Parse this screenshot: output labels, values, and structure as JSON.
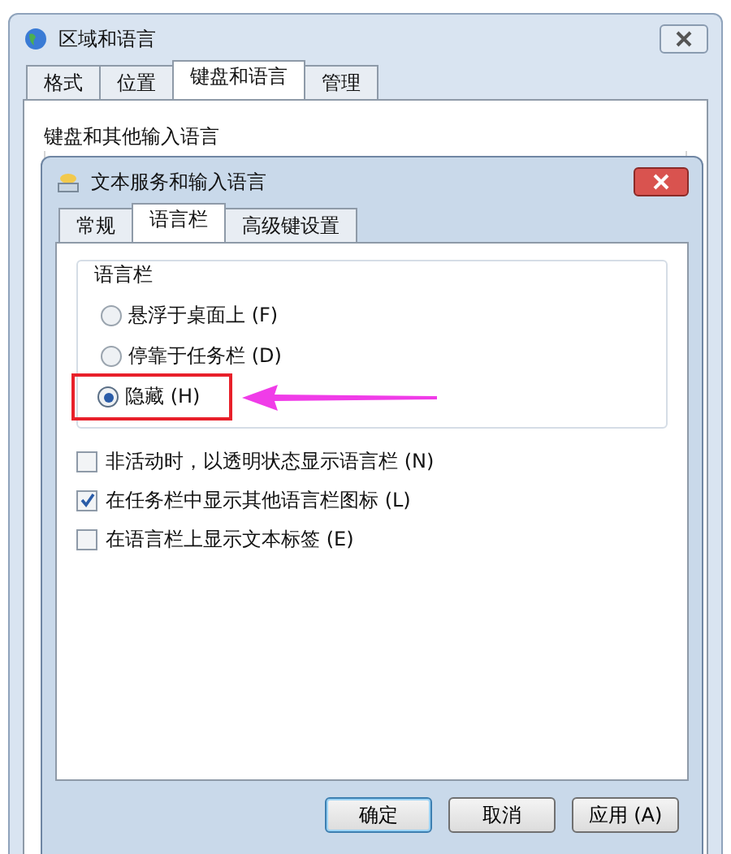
{
  "window": {
    "title": "区域和语言"
  },
  "tabs": [
    {
      "label": "格式",
      "selected": false
    },
    {
      "label": "位置",
      "selected": false
    },
    {
      "label": "键盘和语言",
      "selected": true
    },
    {
      "label": "管理",
      "selected": false
    }
  ],
  "group": {
    "title": "键盘和其他输入语言"
  },
  "dialog": {
    "title": "文本服务和输入语言",
    "tabs": [
      {
        "label": "常规",
        "selected": false
      },
      {
        "label": "语言栏",
        "selected": true
      },
      {
        "label": "高级键设置",
        "selected": false
      }
    ],
    "group_title": "语言栏",
    "options": [
      {
        "label": "悬浮于桌面上 (F)",
        "selected": false,
        "highlighted": false
      },
      {
        "label": "停靠于任务栏 (D)",
        "selected": false,
        "highlighted": false
      },
      {
        "label": "隐藏 (H)",
        "selected": true,
        "highlighted": true
      }
    ],
    "checkboxes": [
      {
        "label": "非活动时，以透明状态显示语言栏 (N)",
        "checked": false
      },
      {
        "label": "在任务栏中显示其他语言栏图标 (L)",
        "checked": true
      },
      {
        "label": "在语言栏上显示文本标签 (E)",
        "checked": false
      }
    ],
    "buttons": [
      {
        "label": "确定",
        "default": true
      },
      {
        "label": "取消",
        "default": false
      },
      {
        "label": "应用 (A)",
        "default": false
      }
    ]
  }
}
